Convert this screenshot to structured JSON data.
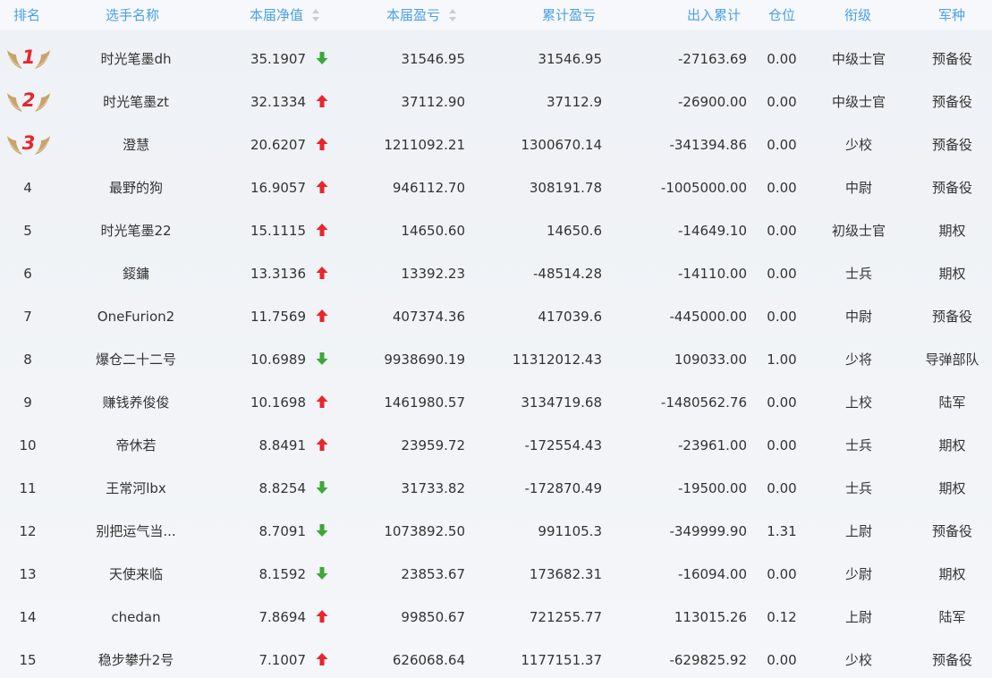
{
  "colors": {
    "header_text": "#4aa0e8",
    "up_arrow": "#e8262b",
    "down_arrow": "#3ba838",
    "medal_number": "#e8262b",
    "medal_wing": "#c9a46a"
  },
  "header": {
    "rank": "排名",
    "name": "选手名称",
    "nav": "本届净值",
    "pnl": "本届盈亏",
    "cum_pnl": "累计盈亏",
    "flow": "出入累计",
    "position": "仓位",
    "title": "衔级",
    "army": "军种"
  },
  "rows": [
    {
      "rank": "1",
      "medal": true,
      "name": "时光笔墨dh",
      "nav": "35.1907",
      "trend": "down",
      "pnl": "31546.95",
      "cum_pnl": "31546.95",
      "flow": "-27163.69",
      "position": "0.00",
      "title": "中级士官",
      "army": "预备役"
    },
    {
      "rank": "2",
      "medal": true,
      "name": "时光笔墨zt",
      "nav": "32.1334",
      "trend": "up",
      "pnl": "37112.90",
      "cum_pnl": "37112.9",
      "flow": "-26900.00",
      "position": "0.00",
      "title": "中级士官",
      "army": "预备役"
    },
    {
      "rank": "3",
      "medal": true,
      "name": "澄慧",
      "nav": "20.6207",
      "trend": "up",
      "pnl": "1211092.21",
      "cum_pnl": "1300670.14",
      "flow": "-341394.86",
      "position": "0.00",
      "title": "少校",
      "army": "预备役"
    },
    {
      "rank": "4",
      "medal": false,
      "name": "最野的狗",
      "nav": "16.9057",
      "trend": "up",
      "pnl": "946112.70",
      "cum_pnl": "308191.78",
      "flow": "-1005000.00",
      "position": "0.00",
      "title": "中尉",
      "army": "预备役"
    },
    {
      "rank": "5",
      "medal": false,
      "name": "时光笔墨22",
      "nav": "15.1115",
      "trend": "up",
      "pnl": "14650.60",
      "cum_pnl": "14650.6",
      "flow": "-14649.10",
      "position": "0.00",
      "title": "初级士官",
      "army": "期权"
    },
    {
      "rank": "6",
      "medal": false,
      "name": "錽鏞",
      "nav": "13.3136",
      "trend": "up",
      "pnl": "13392.23",
      "cum_pnl": "-48514.28",
      "flow": "-14110.00",
      "position": "0.00",
      "title": "士兵",
      "army": "期权"
    },
    {
      "rank": "7",
      "medal": false,
      "name": "OneFurion2",
      "nav": "11.7569",
      "trend": "up",
      "pnl": "407374.36",
      "cum_pnl": "417039.6",
      "flow": "-445000.00",
      "position": "0.00",
      "title": "中尉",
      "army": "预备役"
    },
    {
      "rank": "8",
      "medal": false,
      "name": "爆仓二十二号",
      "nav": "10.6989",
      "trend": "down",
      "pnl": "9938690.19",
      "cum_pnl": "11312012.43",
      "flow": "109033.00",
      "position": "1.00",
      "title": "少将",
      "army": "导弹部队"
    },
    {
      "rank": "9",
      "medal": false,
      "name": "赚钱养俊俊",
      "nav": "10.1698",
      "trend": "up",
      "pnl": "1461980.57",
      "cum_pnl": "3134719.68",
      "flow": "-1480562.76",
      "position": "0.00",
      "title": "上校",
      "army": "陆军"
    },
    {
      "rank": "10",
      "medal": false,
      "name": "帝休若",
      "nav": "8.8491",
      "trend": "up",
      "pnl": "23959.72",
      "cum_pnl": "-172554.43",
      "flow": "-23961.00",
      "position": "0.00",
      "title": "士兵",
      "army": "期权"
    },
    {
      "rank": "11",
      "medal": false,
      "name": "王常河lbx",
      "nav": "8.8254",
      "trend": "down",
      "pnl": "31733.82",
      "cum_pnl": "-172870.49",
      "flow": "-19500.00",
      "position": "0.00",
      "title": "士兵",
      "army": "期权"
    },
    {
      "rank": "12",
      "medal": false,
      "name": "别把运气当...",
      "nav": "8.7091",
      "trend": "down",
      "pnl": "1073892.50",
      "cum_pnl": "991105.3",
      "flow": "-349999.90",
      "position": "1.31",
      "title": "上尉",
      "army": "预备役"
    },
    {
      "rank": "13",
      "medal": false,
      "name": "天使来临",
      "nav": "8.1592",
      "trend": "down",
      "pnl": "23853.67",
      "cum_pnl": "173682.31",
      "flow": "-16094.00",
      "position": "0.00",
      "title": "少尉",
      "army": "期权"
    },
    {
      "rank": "14",
      "medal": false,
      "name": "chedan",
      "nav": "7.8694",
      "trend": "up",
      "pnl": "99850.67",
      "cum_pnl": "721255.77",
      "flow": "113015.26",
      "position": "0.12",
      "title": "上尉",
      "army": "陆军"
    },
    {
      "rank": "15",
      "medal": false,
      "name": "稳步攀升2号",
      "nav": "7.1007",
      "trend": "up",
      "pnl": "626068.64",
      "cum_pnl": "1177151.37",
      "flow": "-629825.92",
      "position": "0.00",
      "title": "少校",
      "army": "预备役"
    }
  ]
}
